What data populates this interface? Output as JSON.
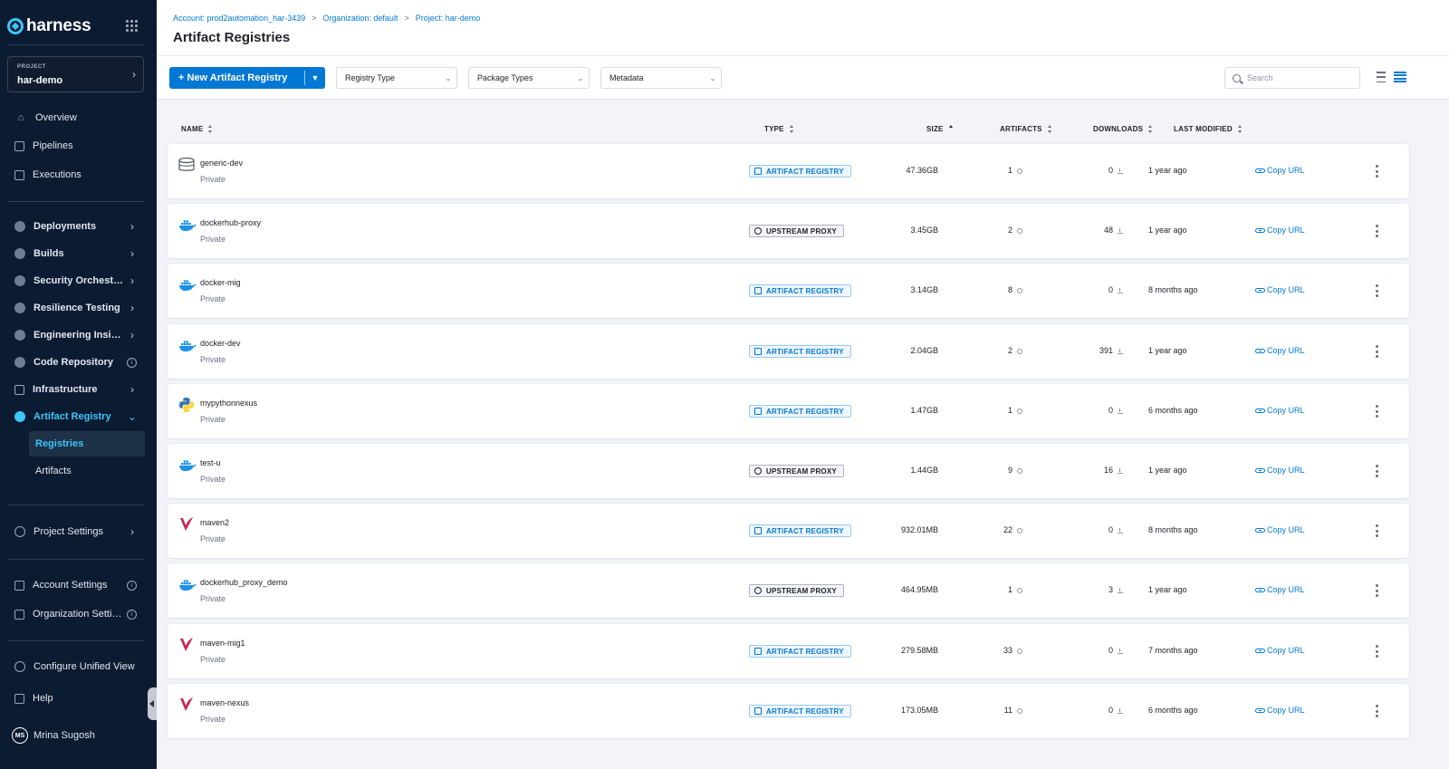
{
  "brand": {
    "name": "harness"
  },
  "project": {
    "kicker": "PROJECT",
    "name": "har-demo"
  },
  "nav": {
    "overview": "Overview",
    "pipelines": "Pipelines",
    "executions": "Executions",
    "deployments": "Deployments",
    "builds": "Builds",
    "security": "Security Orchestrat...",
    "resilience": "Resilience Testing",
    "insights": "Engineering Insights",
    "code_repo": "Code Repository",
    "infrastructure": "Infrastructure",
    "artifact_registry": "Artifact Registry",
    "registries": "Registries",
    "artifacts": "Artifacts",
    "project_settings": "Project Settings",
    "account_settings": "Account Settings",
    "org_settings": "Organization Settings",
    "configure_view": "Configure Unified View",
    "help": "Help",
    "user_initials": "MS",
    "user_name": "Mrina Sugosh"
  },
  "breadcrumb": {
    "account": "Account: prod2automation_har-3439",
    "organization": "Organization: default",
    "project": "Project: har-demo",
    "separator": ">"
  },
  "page": {
    "title": "Artifact Registries"
  },
  "toolbar": {
    "new_button": "+ New Artifact Registry",
    "registry_type": "Registry Type",
    "package_types": "Package Types",
    "metadata": "Metadata",
    "search_placeholder": "Search"
  },
  "table": {
    "columns": {
      "name": "NAME",
      "type": "TYPE",
      "size": "SIZE",
      "artifacts": "ARTIFACTS",
      "downloads": "DOWNLOADS",
      "last_modified": "LAST MODIFIED"
    },
    "copy_url_label": "Copy URL",
    "rows": [
      {
        "icon": "generic-icon",
        "name": "generic-dev",
        "visibility": "Private",
        "type": "ARTIFACT REGISTRY",
        "size": "47.36GB",
        "artifacts": "1",
        "downloads": "0",
        "modified": "1 year ago"
      },
      {
        "icon": "docker-icon",
        "name": "dockerhub-proxy",
        "visibility": "Private",
        "type": "UPSTREAM PROXY",
        "size": "3.45GB",
        "artifacts": "2",
        "downloads": "48",
        "modified": "1 year ago"
      },
      {
        "icon": "docker-icon",
        "name": "docker-mig",
        "visibility": "Private",
        "type": "ARTIFACT REGISTRY",
        "size": "3.14GB",
        "artifacts": "8",
        "downloads": "0",
        "modified": "8 months ago"
      },
      {
        "icon": "docker-icon",
        "name": "docker-dev",
        "visibility": "Private",
        "type": "ARTIFACT REGISTRY",
        "size": "2.04GB",
        "artifacts": "2",
        "downloads": "391",
        "modified": "1 year ago"
      },
      {
        "icon": "python-icon",
        "name": "mypythonnexus",
        "visibility": "Private",
        "type": "ARTIFACT REGISTRY",
        "size": "1.47GB",
        "artifacts": "1",
        "downloads": "0",
        "modified": "6 months ago"
      },
      {
        "icon": "docker-icon",
        "name": "test-u",
        "visibility": "Private",
        "type": "UPSTREAM PROXY",
        "size": "1.44GB",
        "artifacts": "9",
        "downloads": "16",
        "modified": "1 year ago"
      },
      {
        "icon": "maven-icon",
        "name": "maven2",
        "visibility": "Private",
        "type": "ARTIFACT REGISTRY",
        "size": "932.01MB",
        "artifacts": "22",
        "downloads": "0",
        "modified": "8 months ago"
      },
      {
        "icon": "docker-icon",
        "name": "dockerhub_proxy_demo",
        "visibility": "Private",
        "type": "UPSTREAM PROXY",
        "size": "464.95MB",
        "artifacts": "1",
        "downloads": "3",
        "modified": "1 year ago"
      },
      {
        "icon": "maven-icon",
        "name": "maven-mig1",
        "visibility": "Private",
        "type": "ARTIFACT REGISTRY",
        "size": "279.58MB",
        "artifacts": "33",
        "downloads": "0",
        "modified": "7 months ago"
      },
      {
        "icon": "maven-icon",
        "name": "maven-nexus",
        "visibility": "Private",
        "type": "ARTIFACT REGISTRY",
        "size": "173.05MB",
        "artifacts": "11",
        "downloads": "0",
        "modified": "6 months ago"
      }
    ]
  },
  "colors": {
    "sidebar_bg": "#0b1b32",
    "accent": "#0278d5",
    "active_nav": "#3dc7f6",
    "docker_blue": "#1d91e6",
    "maven_red": "#c7254e",
    "python_blue": "#3776ab",
    "python_yellow": "#ffd43b"
  }
}
